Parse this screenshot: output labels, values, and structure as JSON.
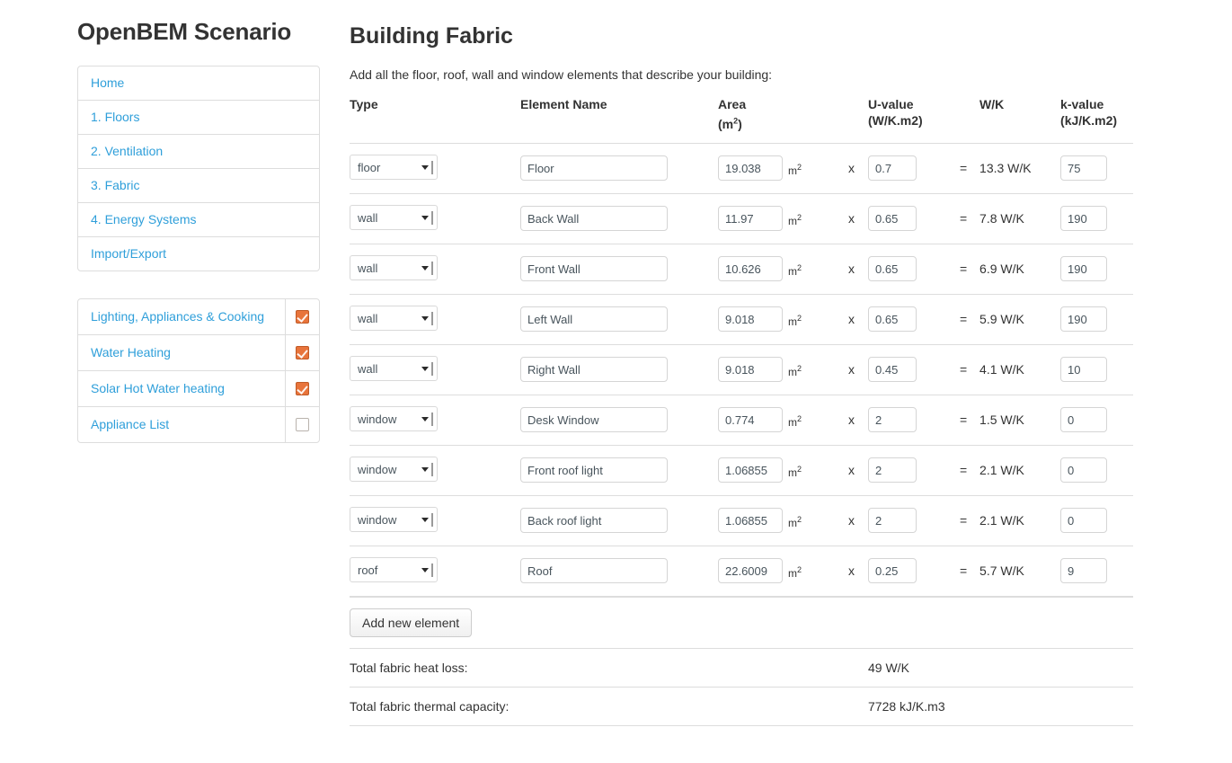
{
  "sidebar": {
    "title": "OpenBEM Scenario",
    "nav": [
      {
        "label": "Home"
      },
      {
        "label": "1. Floors"
      },
      {
        "label": "2. Ventilation"
      },
      {
        "label": "3. Fabric"
      },
      {
        "label": "4. Energy Systems"
      },
      {
        "label": "Import/Export"
      }
    ],
    "modules": [
      {
        "label": "Lighting, Appliances & Cooking",
        "checked": true
      },
      {
        "label": "Water Heating",
        "checked": true
      },
      {
        "label": "Solar Hot Water heating",
        "checked": true
      },
      {
        "label": "Appliance List",
        "checked": false
      }
    ],
    "link_color": "#2f9fda",
    "checkbox_color": "#e8743b"
  },
  "main": {
    "title": "Building Fabric",
    "description": "Add all the floor, roof, wall and window elements that describe your building:",
    "columns": {
      "type": "Type",
      "element_name": "Element Name",
      "area": "Area",
      "area_unit": "(m2)",
      "uvalue": "U-value",
      "uvalue_unit": "(W/K.m2)",
      "wk": "W/K",
      "kvalue": "k-value",
      "kvalue_unit": "(kJ/K.m2)"
    },
    "symbols": {
      "multiply": "x",
      "equals": "=",
      "area_unit_inline": "m",
      "area_unit_sup": "2"
    },
    "rows": [
      {
        "type": "floor",
        "name": "Floor",
        "area": "19.038",
        "uvalue": "0.7",
        "wk": "13.3 W/K",
        "kvalue": "75"
      },
      {
        "type": "wall",
        "name": "Back Wall",
        "area": "11.97",
        "uvalue": "0.65",
        "wk": "7.8 W/K",
        "kvalue": "190"
      },
      {
        "type": "wall",
        "name": "Front Wall",
        "area": "10.626",
        "uvalue": "0.65",
        "wk": "6.9 W/K",
        "kvalue": "190"
      },
      {
        "type": "wall",
        "name": "Left Wall",
        "area": "9.018",
        "uvalue": "0.65",
        "wk": "5.9 W/K",
        "kvalue": "190"
      },
      {
        "type": "wall",
        "name": "Right Wall",
        "area": "9.018",
        "uvalue": "0.45",
        "wk": "4.1 W/K",
        "kvalue": "10"
      },
      {
        "type": "window",
        "name": "Desk Window",
        "area": "0.774",
        "uvalue": "2",
        "wk": "1.5 W/K",
        "kvalue": "0"
      },
      {
        "type": "window",
        "name": "Front roof light",
        "area": "1.06855",
        "uvalue": "2",
        "wk": "2.1 W/K",
        "kvalue": "0"
      },
      {
        "type": "window",
        "name": "Back roof light",
        "area": "1.06855",
        "uvalue": "2",
        "wk": "2.1 W/K",
        "kvalue": "0"
      },
      {
        "type": "roof",
        "name": "Roof",
        "area": "22.6009",
        "uvalue": "0.25",
        "wk": "5.7 W/K",
        "kvalue": "9"
      }
    ],
    "add_button": "Add new element",
    "totals": [
      {
        "label": "Total fabric heat loss:",
        "value": "49 W/K"
      },
      {
        "label": "Total fabric thermal capacity:",
        "value": "7728 kJ/K.m3"
      }
    ]
  }
}
